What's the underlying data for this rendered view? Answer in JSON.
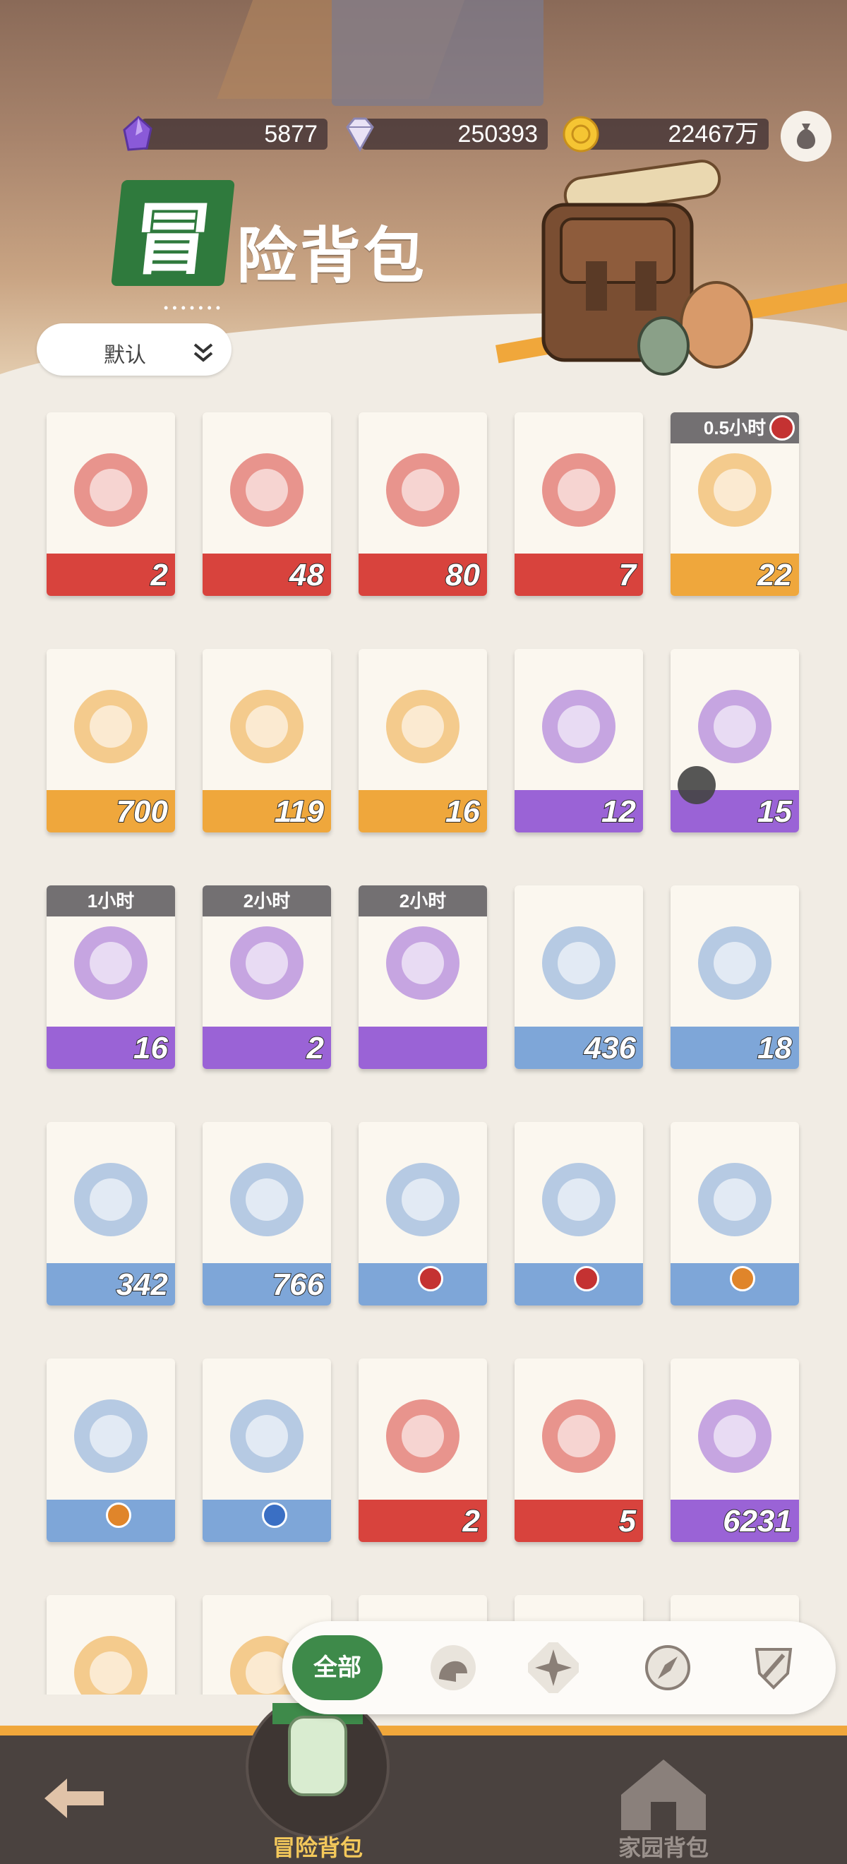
{
  "resources": [
    {
      "name": "purple-crystal",
      "value": "5877"
    },
    {
      "name": "diamond",
      "value": "250393"
    },
    {
      "name": "gold-coin",
      "value": "22467万"
    }
  ],
  "title": {
    "badge": "冒",
    "rest": "险背包",
    "dots": "•••••••"
  },
  "sort": {
    "label": "默认"
  },
  "rows": [
    [
      {
        "qty": "2",
        "band": "#d8433d",
        "icon": "amulet-icon"
      },
      {
        "qty": "48",
        "band": "#d8433d",
        "icon": "red-envelope-icon"
      },
      {
        "qty": "80",
        "band": "#d8433d",
        "icon": "crystal-orb-icon"
      },
      {
        "qty": "7",
        "band": "#d8433d",
        "icon": "brown-envelope-icon"
      },
      {
        "qty": "22",
        "band": "#efa73c",
        "icon": "hourglass-icon",
        "timer": "0.5小时",
        "lock": true
      }
    ],
    [
      {
        "qty": "700",
        "band": "#efa73c",
        "icon": "crescent-icon"
      },
      {
        "qty": "119",
        "band": "#efa73c",
        "icon": "gold-crystal-icon"
      },
      {
        "qty": "16",
        "band": "#efa73c",
        "icon": "white-envelope-icon"
      },
      {
        "qty": "12",
        "band": "#9a63d6",
        "icon": "purple-flame-orb-icon"
      },
      {
        "qty": "15",
        "band": "#9a63d6",
        "icon": "purple-flame-orb-icon",
        "puzzle": true
      }
    ],
    [
      {
        "qty": "16",
        "band": "#9a63d6",
        "icon": "hourglass-icon",
        "timer": "1小时"
      },
      {
        "qty": "2",
        "band": "#9a63d6",
        "icon": "hourglass-icon",
        "timer": "2小时"
      },
      {
        "qty": "",
        "band": "#9a63d6",
        "icon": "purple-hourglass-icon",
        "timer": "2小时"
      },
      {
        "qty": "436",
        "band": "#7ea6d8",
        "icon": "acorn-badge-icon"
      },
      {
        "qty": "18",
        "band": "#7ea6d8",
        "icon": "acorn-badge-icon"
      }
    ],
    [
      {
        "qty": "342",
        "band": "#7ea6d8",
        "icon": "acorn-badge-icon"
      },
      {
        "qty": "766",
        "band": "#7ea6d8",
        "icon": "acorn-badge-icon"
      },
      {
        "qty": "",
        "band": "#7ea6d8",
        "icon": "gold-ticket-icon",
        "chip": "#c43232"
      },
      {
        "qty": "",
        "band": "#7ea6d8",
        "icon": "purple-ticket-icon",
        "chip": "#c43232"
      },
      {
        "qty": "",
        "band": "#7ea6d8",
        "icon": "gold-ticket-icon",
        "chip": "#e0852a"
      }
    ],
    [
      {
        "qty": "",
        "band": "#7ea6d8",
        "icon": "purple-ticket-icon",
        "chip": "#e0852a"
      },
      {
        "qty": "",
        "band": "#7ea6d8",
        "icon": "gold-ticket-icon",
        "chip": "#3a6fc4"
      },
      {
        "qty": "2",
        "band": "#d8433d",
        "icon": "red-chest-icon"
      },
      {
        "qty": "5",
        "band": "#d8433d",
        "icon": "silver-chest-icon"
      },
      {
        "qty": "6231",
        "band": "#9a63d6",
        "icon": "acorn-badge-icon"
      }
    ],
    [
      {
        "qty": "",
        "band": "#efa73c",
        "icon": "scroll-icon"
      },
      {
        "qty": "",
        "band": "#efa73c",
        "icon": "red-gem-icon"
      },
      {
        "qty": "",
        "band": "#efa73c",
        "icon": "item-icon"
      },
      {
        "qty": "",
        "band": "#efa73c",
        "icon": "item-icon"
      },
      {
        "qty": "",
        "band": "#efa73c",
        "icon": "item-icon"
      }
    ]
  ],
  "filter": {
    "all": "全部",
    "icons": [
      "helmet-icon",
      "compass-star-icon",
      "compass-needle-icon",
      "sword-shield-icon"
    ]
  },
  "nav": {
    "active": "冒险背包",
    "home": "家园背包"
  },
  "colors": {
    "accent": "#3e8a4a",
    "gold": "#f3c85b",
    "orange": "#f0a73b"
  }
}
